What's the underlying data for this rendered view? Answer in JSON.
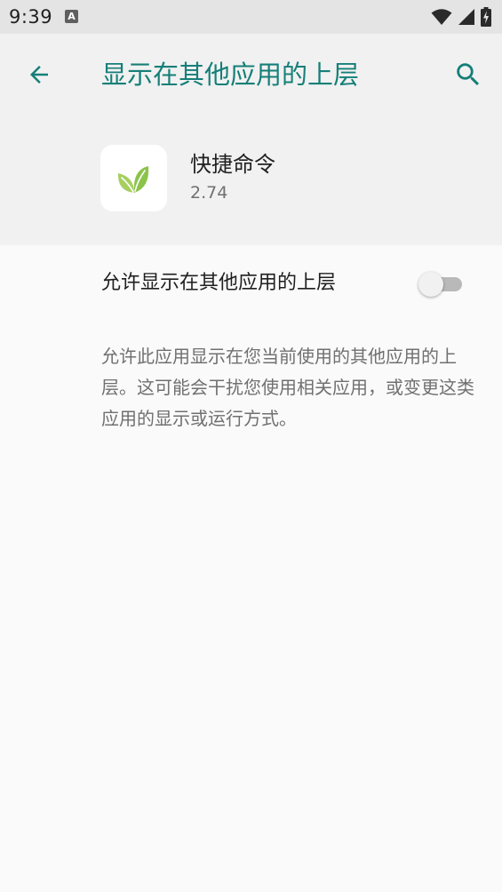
{
  "status_bar": {
    "time": "9:39",
    "notification_icon": "a-letter-icon",
    "notification_letter": "A",
    "icons": [
      "wifi-icon",
      "cellular-signal-icon",
      "battery-charging-icon"
    ]
  },
  "header": {
    "title": "显示在其他应用的上层",
    "back_icon": "arrow-back-icon",
    "search_icon": "search-icon",
    "accent_color": "#157f78"
  },
  "app": {
    "name": "快捷命令",
    "version": "2.74",
    "icon": "leaf-icon",
    "icon_color": "#8cc34b"
  },
  "setting": {
    "label": "允许显示在其他应用的上层",
    "enabled": false
  },
  "description": "允许此应用显示在您当前使用的其他应用的上层。这可能会干扰您使用相关应用，或变更这类应用的显示或运行方式。"
}
